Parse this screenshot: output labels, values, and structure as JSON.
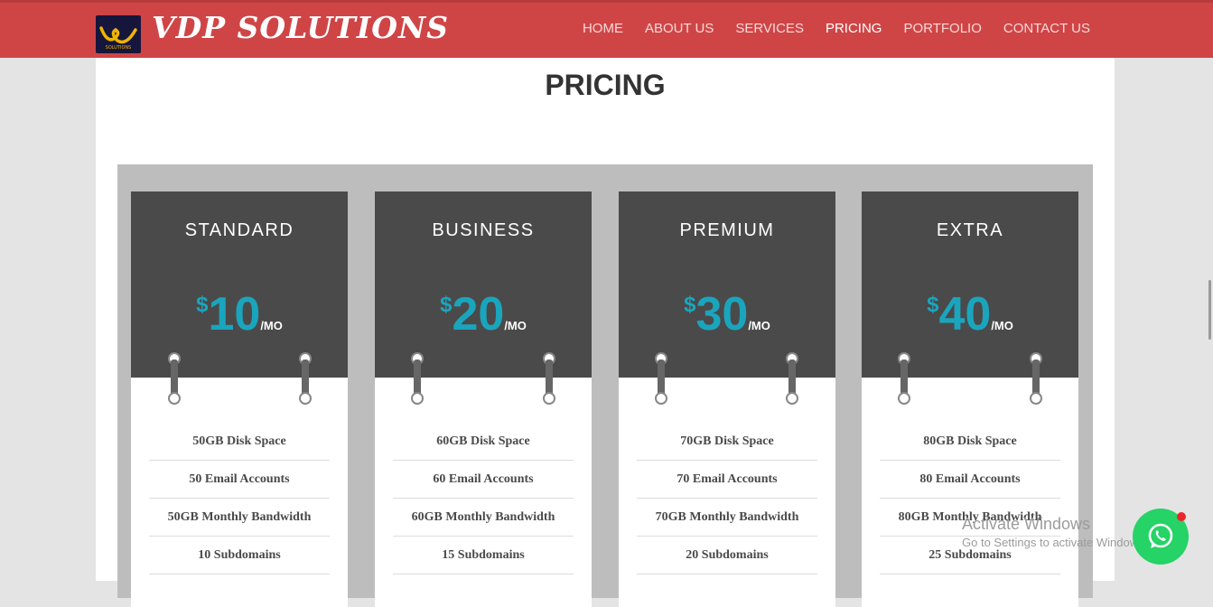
{
  "brand": {
    "name": "VDP SOLUTIONS",
    "logo_text": "SOLUTIONS"
  },
  "nav": {
    "items": [
      "HOME",
      "ABOUT US",
      "SERVICES",
      "PRICING",
      "PORTFOLIO",
      "CONTACT US"
    ],
    "active": "PRICING"
  },
  "page": {
    "title": "PRICING"
  },
  "plans": [
    {
      "name": "STANDARD",
      "currency": "$",
      "amount": "10",
      "period": "/MO",
      "features": [
        "50GB Disk Space",
        "50 Email Accounts",
        "50GB Monthly Bandwidth",
        "10 Subdomains"
      ]
    },
    {
      "name": "BUSINESS",
      "currency": "$",
      "amount": "20",
      "period": "/MO",
      "features": [
        "60GB Disk Space",
        "60 Email Accounts",
        "60GB Monthly Bandwidth",
        "15 Subdomains"
      ]
    },
    {
      "name": "PREMIUM",
      "currency": "$",
      "amount": "30",
      "period": "/MO",
      "features": [
        "70GB Disk Space",
        "70 Email Accounts",
        "70GB Monthly Bandwidth",
        "20 Subdomains"
      ]
    },
    {
      "name": "EXTRA",
      "currency": "$",
      "amount": "40",
      "period": "/MO",
      "features": [
        "80GB Disk Space",
        "80 Email Accounts",
        "80GB Monthly Bandwidth",
        "25 Subdomains"
      ]
    }
  ],
  "watermark": {
    "line1": "Activate Windows",
    "line2": "Go to Settings to activate Windows."
  },
  "colors": {
    "header": "#cf4546",
    "price_accent": "#1aa5bd",
    "card_head": "#4a4a4a",
    "whatsapp": "#25d366"
  },
  "icons": {
    "chat": "whatsapp-icon"
  }
}
